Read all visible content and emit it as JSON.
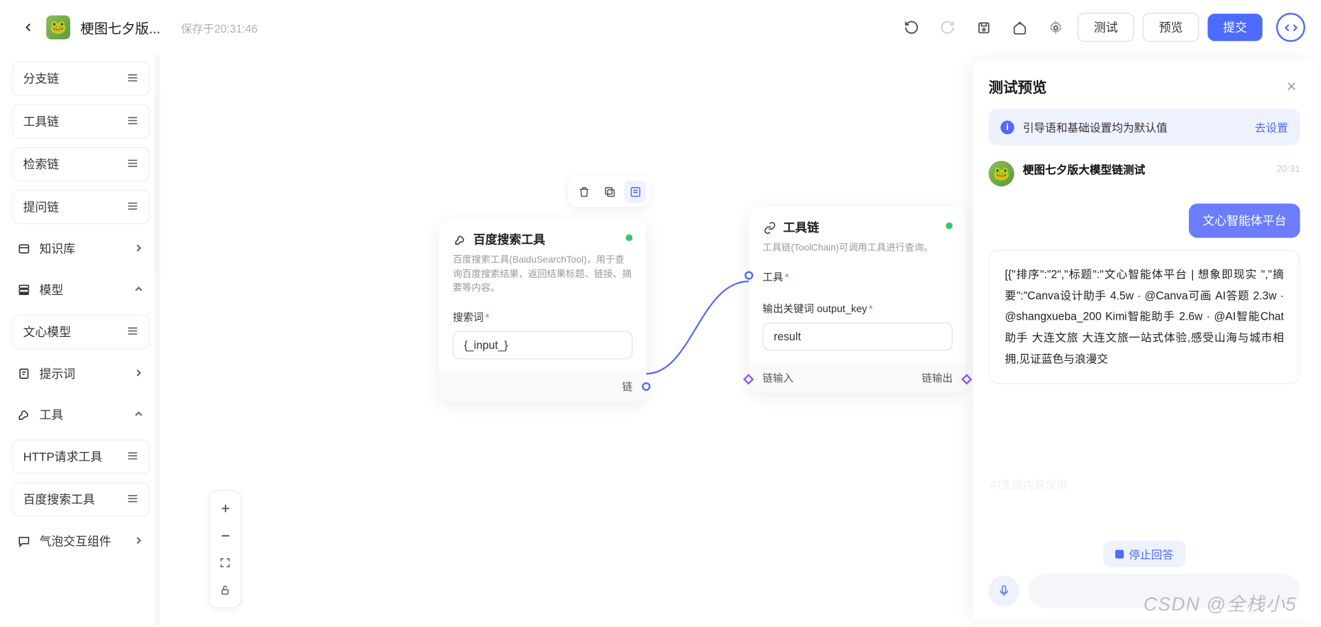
{
  "header": {
    "title": "梗图七夕版...",
    "saved": "保存于20:31:46",
    "test": "测试",
    "preview": "预览",
    "submit": "提交"
  },
  "sidebar": {
    "items": [
      {
        "label": "分支链",
        "type": "box",
        "right": "ham"
      },
      {
        "label": "工具链",
        "type": "box",
        "right": "ham"
      },
      {
        "label": "检索链",
        "type": "box",
        "right": "ham"
      },
      {
        "label": "提问链",
        "type": "box",
        "right": "ham"
      },
      {
        "label": "知识库",
        "type": "bare",
        "icon": "db",
        "right": "chev-r"
      },
      {
        "label": "模型",
        "type": "bare",
        "icon": "stack",
        "right": "chev-u"
      },
      {
        "label": "文心模型",
        "type": "sub",
        "right": "ham"
      },
      {
        "label": "提示词",
        "type": "bare",
        "icon": "note",
        "right": "chev-r"
      },
      {
        "label": "工具",
        "type": "bare",
        "icon": "wrench",
        "right": "chev-u"
      },
      {
        "label": "HTTP请求工具",
        "type": "sub",
        "right": "ham"
      },
      {
        "label": "百度搜索工具",
        "type": "sub",
        "right": "ham"
      },
      {
        "label": "气泡交互组件",
        "type": "bare",
        "icon": "chat",
        "right": "chev-r"
      }
    ]
  },
  "node1": {
    "title": "百度搜索工具",
    "desc": "百度搜索工具(BaiduSearchTool)，用于查询百度搜索结果，返回结果标题、链接、摘要等内容。",
    "field_label": "搜索词",
    "field_value": "{_input_}",
    "footer_right": "链"
  },
  "node2": {
    "title": "工具链",
    "desc": "工具链(ToolChain)可调用工具进行查询。",
    "f1_label": "工具",
    "f2_label": "输出关键词 output_key",
    "f2_value": "result",
    "footer_left": "链输入",
    "footer_right": "链输出"
  },
  "panel": {
    "title": "测试预览",
    "banner_text": "引导语和基础设置均为默认值",
    "banner_link": "去设置",
    "bot_name": "梗图七夕版大模型链测试",
    "bot_time": "20:31",
    "user_msg": "文心智能体平台",
    "asst_msg": "[{\"排序\":\"2\",\"标题\":\"文心智能体平台 | 想象即现实 \",\"摘要\":\"Canva设计助手 4.5w · @Canva可画 AI答题 2.3w · @shangxueba_200 Kimi智能助手 2.6w · @AI智能Chat助手 大连文旅 大连文旅一站式体验,感受山海与城市相拥,见证蓝色与浪漫交",
    "stop": "停止回答"
  },
  "watermark": "CSDN @全栈小5",
  "wm_bg": "AI生成内容仅供"
}
